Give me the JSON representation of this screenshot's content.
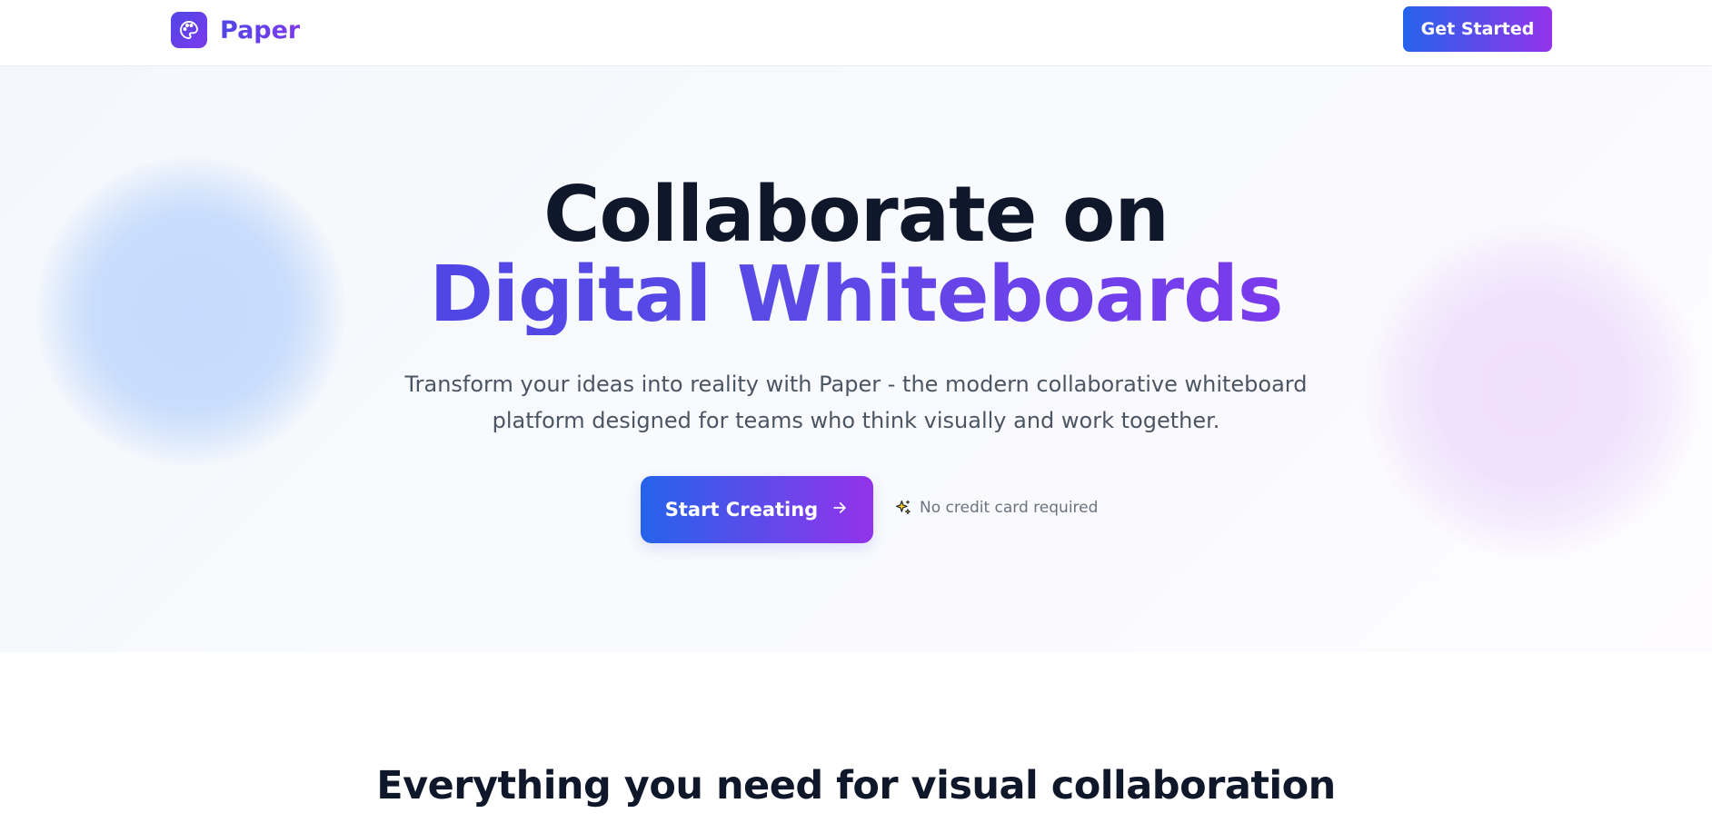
{
  "header": {
    "brand": "Paper",
    "logo_icon": "palette-icon",
    "cta_label": "Get Started"
  },
  "hero": {
    "title_line1": "Collaborate on",
    "title_line2": "Digital Whiteboards",
    "subtitle": "Transform your ideas into reality with Paper - the modern collaborative whiteboard platform designed for teams who think visually and work together.",
    "cta_label": "Start Creating",
    "cta_icon": "arrow-right-icon",
    "note_icon": "sparkles-icon",
    "note": "No credit card required"
  },
  "features": {
    "heading": "Everything you need for visual collaboration"
  },
  "colors": {
    "gradient_start": "#2563eb",
    "gradient_end": "#9333ea",
    "brand_indigo": "#4f46e5",
    "brand_violet": "#7c3aed",
    "heading_text": "#0f172a",
    "body_text": "#4b5563"
  }
}
